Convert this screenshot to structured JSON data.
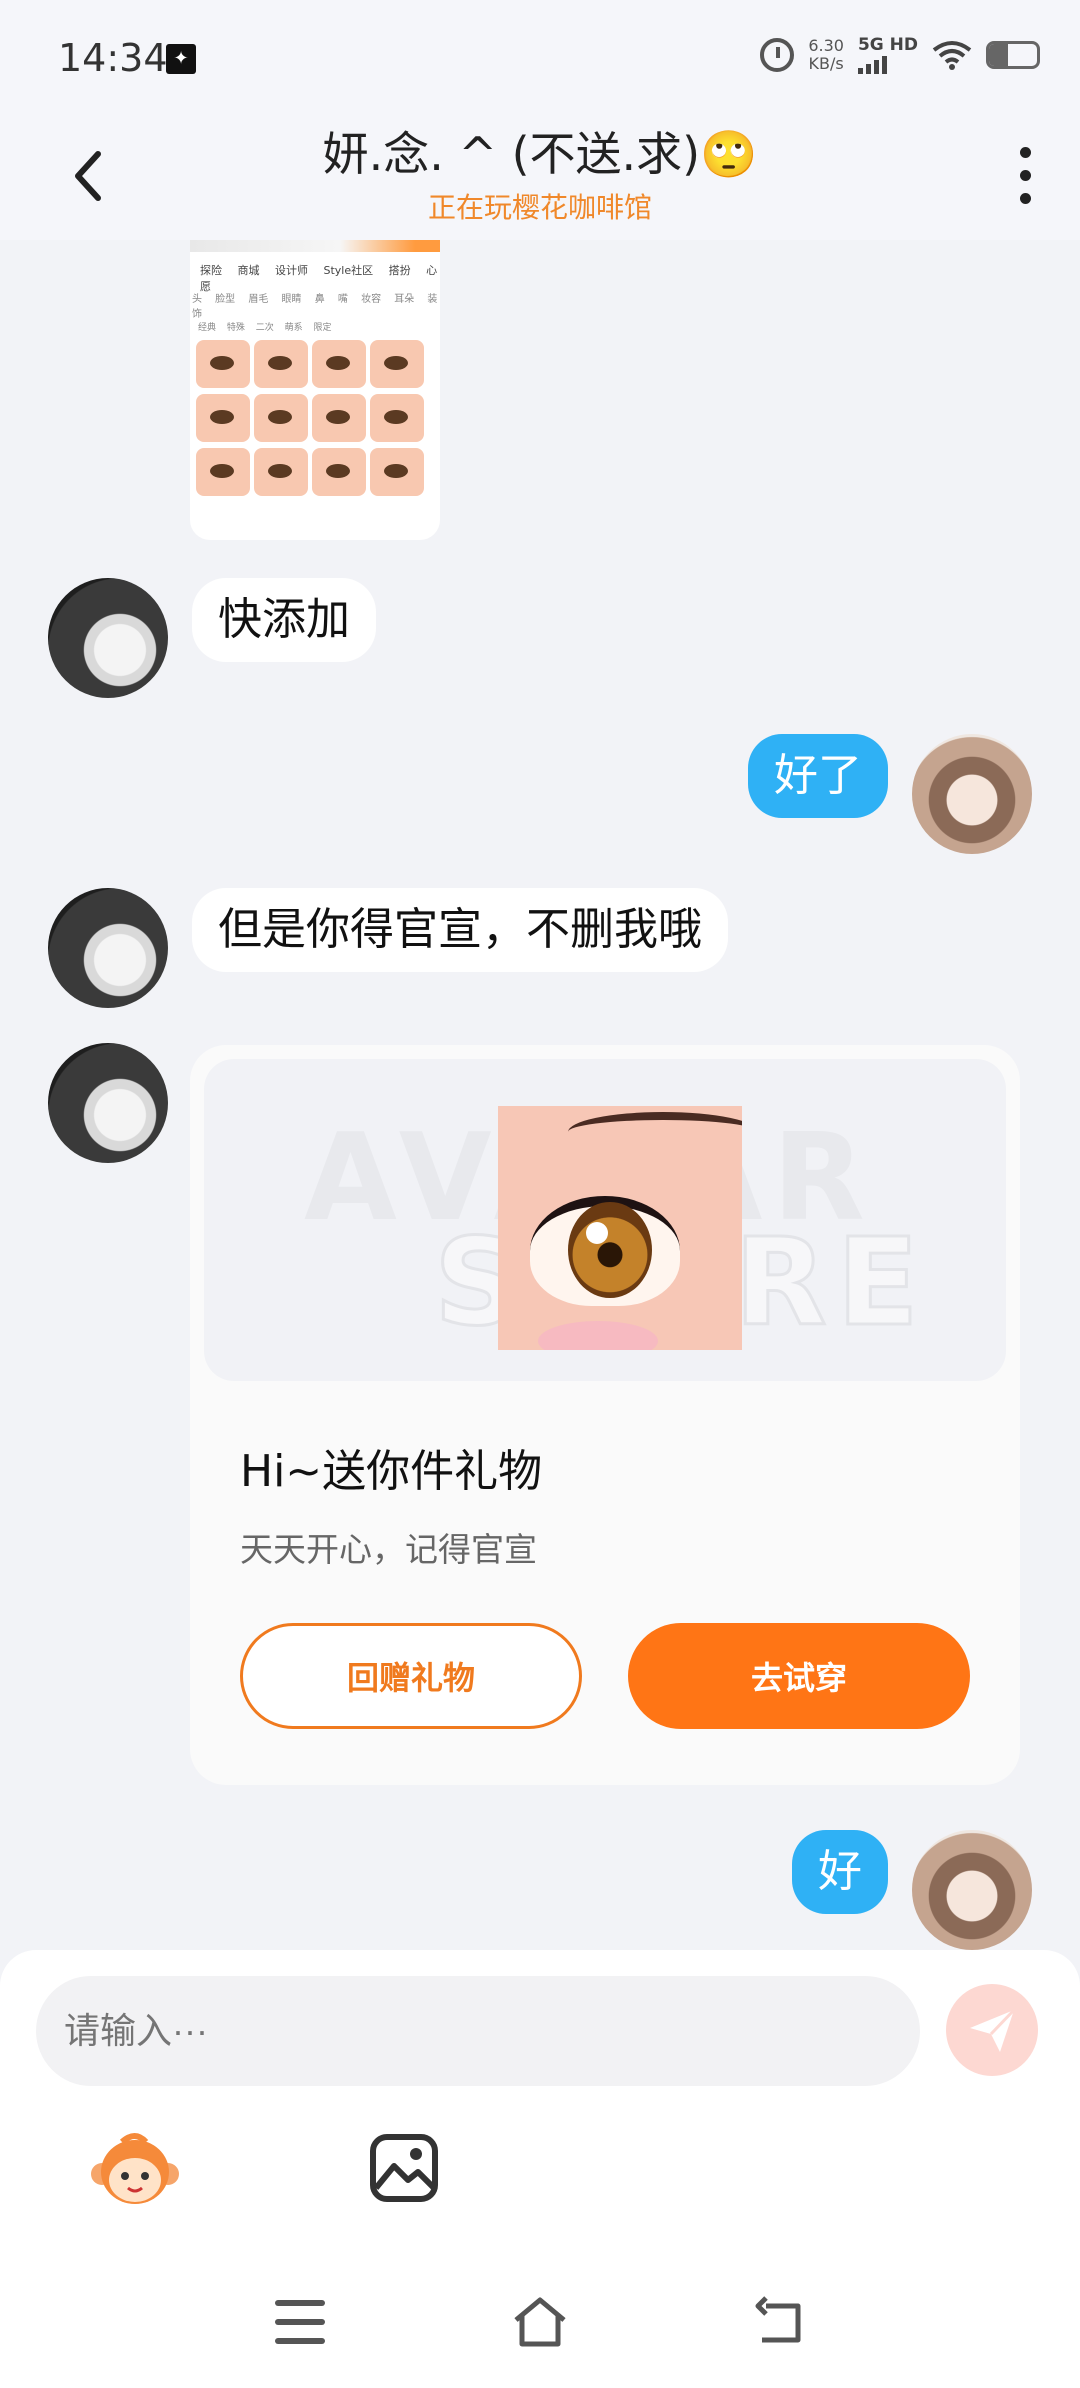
{
  "status_bar": {
    "time": "14:34",
    "speed_value": "6.30",
    "speed_unit": "KB/s",
    "network": "5G HD",
    "icons": [
      "notification-icon",
      "alarm-icon",
      "signal-icon",
      "wifi-icon",
      "battery-icon"
    ],
    "battery_level": 0.4
  },
  "header": {
    "title": "妍.念. ^ (不送.求)🙄",
    "subtitle": "正在玩樱花咖啡馆",
    "icons": [
      "back-arrow-icon",
      "more-vertical-icon"
    ]
  },
  "shared_screenshot": {
    "tabs": "探险 商城 设计师 Style社区 搭扮 心愿",
    "subtabs": "头 脸型 眉毛 眼睛 鼻 嘴 妆容 耳朵 装饰",
    "filters": "经典 特殊 二次 萌系 限定"
  },
  "messages": [
    {
      "side": "in",
      "text": "快添加"
    },
    {
      "side": "out",
      "text": "好了"
    },
    {
      "side": "in",
      "text": "但是你得官宣，不删我哦"
    },
    {
      "side": "out",
      "text": "好"
    }
  ],
  "gift_card": {
    "watermark_line1": "AVATAR",
    "watermark_line2": "STORE",
    "title": "Hi~送你件礼物",
    "description": "天天开心，记得官宣",
    "return_gift_label": "回赠礼物",
    "try_on_label": "去试穿",
    "accent_color": "#ff7515"
  },
  "input": {
    "placeholder": "请输入···",
    "icons": [
      "send-icon",
      "monkey-emoji-icon",
      "image-icon"
    ]
  },
  "nav_bar": {
    "icons": [
      "menu-icon",
      "home-icon",
      "back-icon"
    ]
  }
}
